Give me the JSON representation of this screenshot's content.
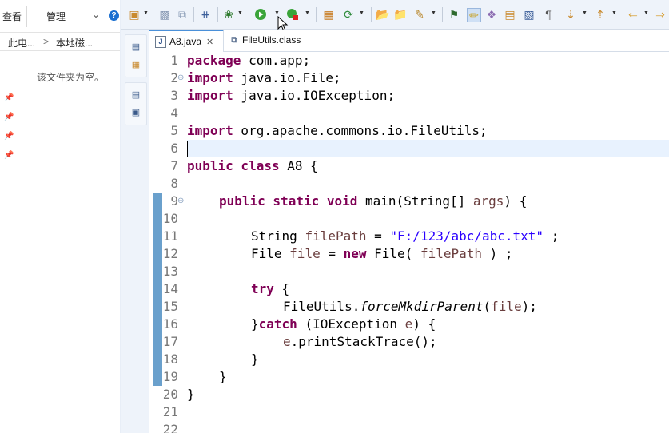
{
  "explorer": {
    "menu": {
      "view": "查看",
      "manage": "管理"
    },
    "breadcrumb": [
      "此电...",
      "本地磁..."
    ],
    "breadcrumb_sep": ">",
    "empty_text": "该文件夹为空。"
  },
  "editor": {
    "tabs": [
      {
        "label": "A8.java",
        "active": true
      },
      {
        "label": "FileUtils.class",
        "active": false
      }
    ],
    "close_glyph": "✕",
    "lines": [
      "1",
      "2",
      "3",
      "4",
      "5",
      "6",
      "7",
      "8",
      "9",
      "10",
      "11",
      "12",
      "13",
      "14",
      "15",
      "16",
      "17",
      "18",
      "19",
      "20",
      "21",
      "22"
    ],
    "code": {
      "l1_kw": "package",
      "l1_rest": " com.app;",
      "l2_kw": "import",
      "l2_rest": " java.io.File;",
      "l3_kw": "import",
      "l3_rest": " java.io.IOException;",
      "l5_kw": "import",
      "l5_rest": " org.apache.commons.io.FileUtils;",
      "l7_kw": "public class",
      "l7_rest": " A8 {",
      "l9_kw": "public static void",
      "l9_rest": " main(String[] ",
      "l9_var": "args",
      "l9_end": ") {",
      "l11_type": "String ",
      "l11_var": "filePath",
      "l11_eq": " = ",
      "l11_str": "\"F:/123/abc/abc.txt\"",
      "l11_end": " ;",
      "l12_type": "File ",
      "l12_var": "file",
      "l12_eq": " = ",
      "l12_kw": "new",
      "l12_mid": " File( ",
      "l12_var2": "filePath",
      "l12_end": " ) ;",
      "l14_kw": "try",
      "l14_rest": " {",
      "l15_a": "FileUtils.",
      "l15_method": "forceMkdirParent",
      "l15_b": "(",
      "l15_var": "file",
      "l15_c": ");",
      "l16_a": "}",
      "l16_kw": "catch",
      "l16_b": " (IOException ",
      "l16_var": "e",
      "l16_c": ") {",
      "l17_var": "e",
      "l17_rest": ".printStackTrace();",
      "l18": "}",
      "l19": "}",
      "l20": "}"
    }
  },
  "colors": {
    "keyword": "#7f0055",
    "string": "#2a00ff",
    "variable": "#6a3e3e",
    "current_line": "#e8f2fe"
  }
}
